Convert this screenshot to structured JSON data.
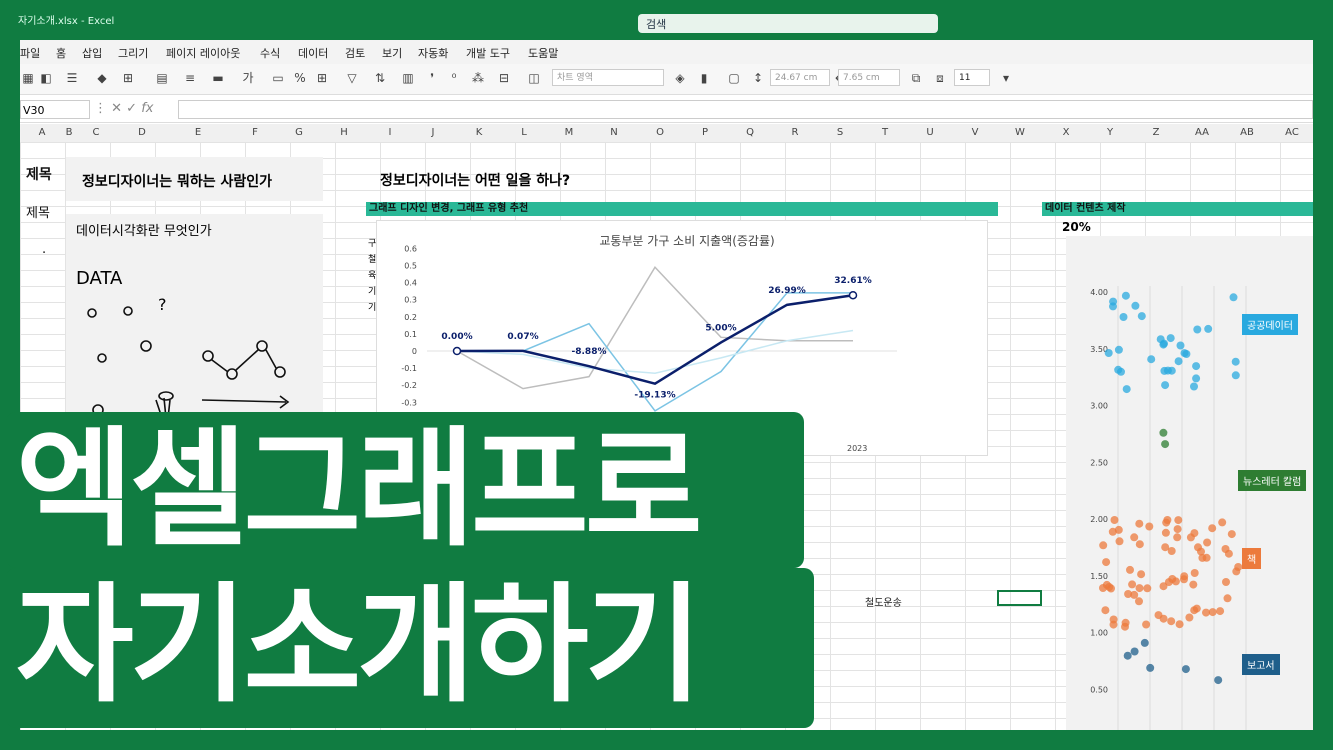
{
  "window": {
    "title": "자기소개.xlsx - Excel",
    "search_placeholder": "검색"
  },
  "menu": [
    "파일",
    "홈",
    "삽입",
    "그리기",
    "페이지 레이아웃",
    "수식",
    "데이터",
    "검토",
    "보기",
    "자동화",
    "개발 도구",
    "도움말"
  ],
  "ribbon": {
    "chart_area_dropdown": "차트 영역",
    "height_value": "24.67 cm",
    "width_value": "7.65 cm",
    "font_size": "11"
  },
  "formula_bar": {
    "name_box": "V30",
    "fx": "fx"
  },
  "columns": [
    "A",
    "B",
    "C",
    "D",
    "E",
    "F",
    "G",
    "H",
    "I",
    "J",
    "K",
    "L",
    "M",
    "N",
    "O",
    "P",
    "Q",
    "R",
    "S",
    "T",
    "U",
    "V",
    "W",
    "X",
    "Y",
    "Z",
    "AA",
    "AB",
    "AC"
  ],
  "sheet": {
    "row_title_label": "제목",
    "row_title_label2": "제목",
    "bullet": "·",
    "left_heading": "정보디자이너는 뭐하는 사람인가",
    "left_subheading": "데이터시각화란 무엇인가",
    "sketch_text": "DATA",
    "sketch_question": "?",
    "middle_heading": "정보디자이너는 어떤 일을 하나?",
    "middle_teal_label": "그래프 디자인 변경, 그래프 유형 추천",
    "left_side_chars": [
      "구",
      "철",
      "육",
      "기",
      "기"
    ],
    "right_teal_label": "데이터 컨텐츠 제작",
    "right_percent": "20%",
    "railway_label": "철도운송"
  },
  "line_chart": {
    "title": "교통부분 가구 소비 지출액(증감률)",
    "y_ticks": [
      "0.6",
      "0.5",
      "0.4",
      "0.3",
      "0.2",
      "0.1",
      "0",
      "-0.1",
      "-0.2",
      "-0.3"
    ],
    "x_label_visible": "2023",
    "main_series_labels": [
      "0.00%",
      "0.07%",
      "-8.88%",
      "-19.13%",
      "5.00%",
      "26.99%",
      "32.61%"
    ],
    "main_series_values": [
      0.0,
      0.0007,
      -0.0888,
      -0.1913,
      0.05,
      0.2699,
      0.3261
    ],
    "bg_series": [
      {
        "values": [
          0,
          -0.22,
          -0.15,
          0.49,
          0.08,
          0.06,
          0.06
        ],
        "color": "#bdbdbd"
      },
      {
        "values": [
          0,
          0,
          0.16,
          -0.35,
          -0.12,
          0.34,
          0.34
        ],
        "color": "#7cc4e4"
      },
      {
        "values": [
          0,
          -0.02,
          -0.1,
          -0.13,
          -0.04,
          0.06,
          0.12
        ],
        "color": "#c7e8f3"
      }
    ],
    "main_color": "#0b1f6b"
  },
  "scatter_chart": {
    "y_ticks": [
      "4.00",
      "3.50",
      "3.00",
      "2.50",
      "2.00",
      "1.50",
      "1.00",
      "0.50"
    ],
    "legend": [
      {
        "label": "공공데이터",
        "color": "#29a9df"
      },
      {
        "label": "뉴스레터 칼럼",
        "color": "#2e7d32"
      },
      {
        "label": "책",
        "color": "#ec7a3c"
      },
      {
        "label": "보고서",
        "color": "#1f5f8b"
      }
    ]
  },
  "banner": {
    "line1": "엑셀그래프로",
    "line2": "자기소개하기"
  },
  "colors": {
    "excel_green": "#107c41",
    "teal": "#2ab897"
  }
}
